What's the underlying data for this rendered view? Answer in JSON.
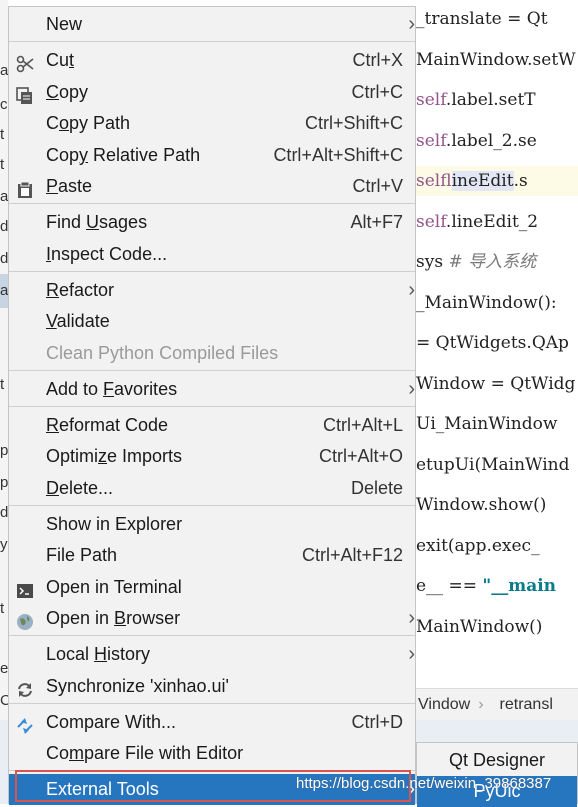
{
  "editor": {
    "lines": [
      {
        "pre": "_translate = Qt",
        "self": "",
        "word": "",
        "post": "",
        "comment": "",
        "str": ""
      },
      {
        "pre": "MainWindow.setW",
        "self": "",
        "word": "",
        "post": "",
        "comment": "",
        "str": ""
      },
      {
        "pre": "",
        "self": "self",
        "word": "",
        "post": ".label.setT",
        "comment": "",
        "str": ""
      },
      {
        "pre": "",
        "self": "self",
        "word": "",
        "post": ".label_2.se",
        "comment": "",
        "str": ""
      },
      {
        "pre": "",
        "self": "self",
        "word": "lineEdit",
        "post": ".s",
        "comment": "",
        "str": ""
      },
      {
        "pre": "",
        "self": "self",
        "word": "",
        "post": ".lineEdit_2",
        "comment": "",
        "str": ""
      },
      {
        "pre": "sys  ",
        "self": "",
        "word": "",
        "post": "",
        "comment": "# 导入系统",
        "str": ""
      },
      {
        "pre": "_MainWindow():",
        "self": "",
        "word": "",
        "post": "",
        "comment": "",
        "str": ""
      },
      {
        "pre": "= QtWidgets.QAp",
        "self": "",
        "word": "",
        "post": "",
        "comment": "",
        "str": ""
      },
      {
        "pre": "Window = QtWidg",
        "self": "",
        "word": "",
        "post": "",
        "comment": "",
        "str": ""
      },
      {
        "pre": "  Ui_MainWindow",
        "self": "",
        "word": "",
        "post": "",
        "comment": "",
        "str": ""
      },
      {
        "pre": "etupUi(MainWind",
        "self": "",
        "word": "",
        "post": "",
        "comment": "",
        "str": ""
      },
      {
        "pre": "Window.show()",
        "self": "",
        "word": "",
        "post": "",
        "comment": "",
        "str": ""
      },
      {
        "pre": "exit(app.exec_",
        "self": "",
        "word": "",
        "post": "",
        "comment": "",
        "str": ""
      },
      {
        "pre": "e__ == ",
        "self": "",
        "word": "",
        "post": "",
        "comment": "",
        "str": "\"__main"
      },
      {
        "pre": "MainWindow()",
        "self": "",
        "word": "",
        "post": "",
        "comment": "",
        "str": ""
      }
    ],
    "breadcrumb": [
      "Vindow",
      "retransl"
    ]
  },
  "gutter_letters": [
    "a",
    "c",
    "t",
    "t",
    "a",
    "d",
    "d",
    "a",
    "t",
    "p",
    "p",
    "d",
    "y",
    "t",
    "e",
    "C",
    "D"
  ],
  "menu": {
    "items": [
      {
        "pre": "New",
        "u": "",
        "post": "",
        "shortcut": "",
        "submenu": true,
        "icon": ""
      },
      {
        "pre": "Cu",
        "u": "t",
        "post": "",
        "shortcut": "Ctrl+X",
        "submenu": false,
        "icon": "scissors-icon"
      },
      {
        "pre": "",
        "u": "C",
        "post": "opy",
        "shortcut": "Ctrl+C",
        "submenu": false,
        "icon": "copy-icon"
      },
      {
        "pre": "C",
        "u": "o",
        "post": "py Path",
        "shortcut": "Ctrl+Shift+C",
        "submenu": false,
        "icon": ""
      },
      {
        "pre": "Cop",
        "u": "y",
        "post": " Relative Path",
        "shortcut": "Ctrl+Alt+Shift+C",
        "submenu": false,
        "icon": ""
      },
      {
        "pre": "",
        "u": "P",
        "post": "aste",
        "shortcut": "Ctrl+V",
        "submenu": false,
        "icon": "clipboard-icon"
      },
      {
        "pre": "Find ",
        "u": "U",
        "post": "sages",
        "shortcut": "Alt+F7",
        "submenu": false,
        "icon": ""
      },
      {
        "pre": "",
        "u": "I",
        "post": "nspect Code...",
        "shortcut": "",
        "submenu": false,
        "icon": ""
      },
      {
        "pre": "",
        "u": "R",
        "post": "efactor",
        "shortcut": "",
        "submenu": true,
        "icon": ""
      },
      {
        "pre": "",
        "u": "V",
        "post": "alidate",
        "shortcut": "",
        "submenu": false,
        "icon": ""
      },
      {
        "pre": "Clean Python Compiled Files",
        "u": "",
        "post": "",
        "shortcut": "",
        "submenu": false,
        "icon": "",
        "disabled": true
      },
      {
        "pre": "Add to ",
        "u": "F",
        "post": "avorites",
        "shortcut": "",
        "submenu": true,
        "icon": ""
      },
      {
        "pre": "",
        "u": "R",
        "post": "eformat Code",
        "shortcut": "Ctrl+Alt+L",
        "submenu": false,
        "icon": ""
      },
      {
        "pre": "Optimi",
        "u": "z",
        "post": "e Imports",
        "shortcut": "Ctrl+Alt+O",
        "submenu": false,
        "icon": ""
      },
      {
        "pre": "",
        "u": "D",
        "post": "elete...",
        "shortcut": "Delete",
        "submenu": false,
        "icon": ""
      },
      {
        "pre": "Show in Explorer",
        "u": "",
        "post": "",
        "shortcut": "",
        "submenu": false,
        "icon": ""
      },
      {
        "pre": "File Path",
        "u": "",
        "post": "",
        "shortcut": "Ctrl+Alt+F12",
        "submenu": false,
        "icon": ""
      },
      {
        "pre": "Open in Terminal",
        "u": "",
        "post": "",
        "shortcut": "",
        "submenu": false,
        "icon": "terminal-icon"
      },
      {
        "pre": "Open in ",
        "u": "B",
        "post": "rowser",
        "shortcut": "",
        "submenu": true,
        "icon": "globe-icon"
      },
      {
        "pre": "Local ",
        "u": "H",
        "post": "istory",
        "shortcut": "",
        "submenu": true,
        "icon": ""
      },
      {
        "pre": "Synchronize 'xinhao.ui'",
        "u": "",
        "post": "",
        "shortcut": "",
        "submenu": false,
        "icon": "sync-icon"
      },
      {
        "pre": "Compare With...",
        "u": "",
        "post": "",
        "shortcut": "Ctrl+D",
        "submenu": false,
        "icon": "compare-icon"
      },
      {
        "pre": "Co",
        "u": "m",
        "post": "pare File with Editor",
        "shortcut": "",
        "submenu": false,
        "icon": ""
      },
      {
        "pre": "External Tools",
        "u": "",
        "post": "",
        "shortcut": "",
        "submenu": true,
        "icon": "",
        "active": true
      }
    ]
  },
  "submenu": {
    "items": [
      "Qt Designer",
      "PyUic"
    ]
  },
  "watermark": "https://blog.csdn.net/weixin_39868387",
  "colors": {
    "active": "#2675bf",
    "outline": "#d9534f",
    "menu_bg": "#f2f2f2"
  }
}
